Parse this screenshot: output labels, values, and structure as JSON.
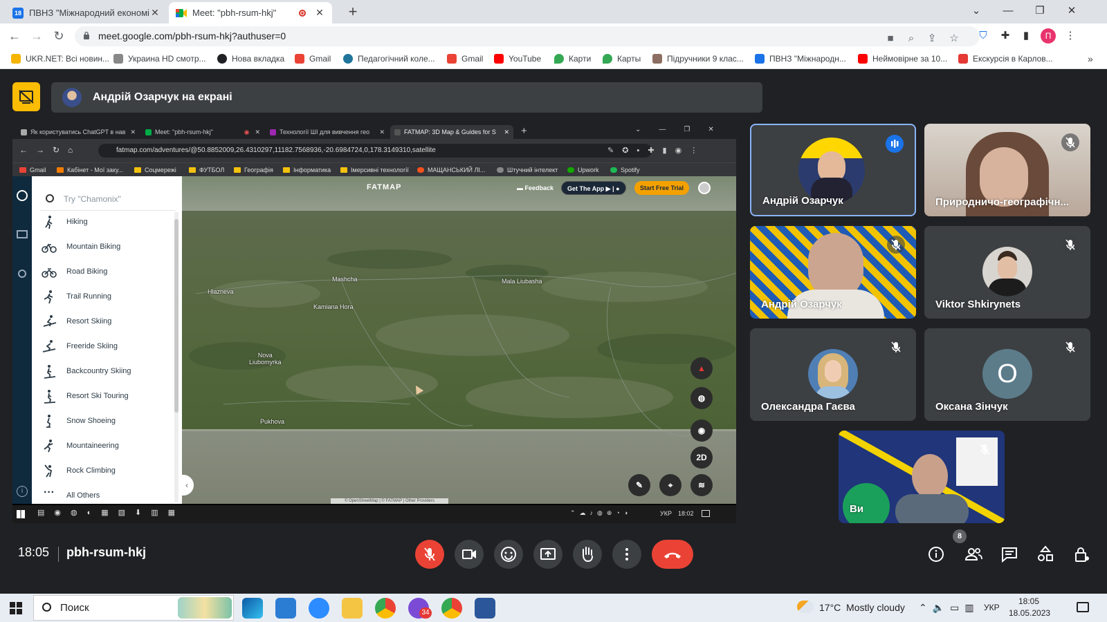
{
  "browser": {
    "tabs": [
      {
        "title": "ПВНЗ \"Міжнародний економіко",
        "favicon_color": "#1a73e8",
        "favicon_text": "18"
      },
      {
        "title": "Meet: \"pbh-rsum-hkj\"",
        "favicon_color": "#00ac47",
        "active": true
      }
    ],
    "window_controls": {
      "list": "⌄",
      "minimize": "—",
      "maximize": "❐",
      "close": "✕"
    },
    "new_tab": "+",
    "url": "meet.google.com/pbh-rsum-hkj?authuser=0",
    "profile_initial": "П",
    "bookmarks": [
      {
        "label": "UKR.NET: Всі новин...",
        "color": "#f4b400"
      },
      {
        "label": "Украина HD смотр...",
        "color": "#888888"
      },
      {
        "label": "Нова вкладка",
        "color": "#202124"
      },
      {
        "label": "Gmail",
        "color": "#ea4335"
      },
      {
        "label": "Педагогічний коле...",
        "color": "#21759b"
      },
      {
        "label": "Gmail",
        "color": "#ea4335"
      },
      {
        "label": "YouTube",
        "color": "#ff0000"
      },
      {
        "label": "Карти",
        "color": "#34a853"
      },
      {
        "label": "Карты",
        "color": "#34a853"
      },
      {
        "label": "Підручники 9 клас...",
        "color": "#8d6e63"
      },
      {
        "label": "ПВНЗ \"Міжнародн...",
        "color": "#1a73e8"
      },
      {
        "label": "Неймовірне за 10...",
        "color": "#ff0000"
      },
      {
        "label": "Екскурсія в Карлов...",
        "color": "#e53935"
      }
    ],
    "bookmarks_more": "»"
  },
  "meet": {
    "presenter_banner": "Андрій Озарчук на екрані",
    "time": "18:05",
    "meeting_code": "pbh-rsum-hkj",
    "participant_count": "8",
    "tiles": [
      {
        "name": "Андрій Озарчук",
        "type": "avatar",
        "speaking": true
      },
      {
        "name": "Природничо-географічн...",
        "type": "video",
        "muted": true
      },
      {
        "name": "Андрій Озарчук",
        "type": "video",
        "muted": true
      },
      {
        "name": "Viktor Shkirynets",
        "type": "avatar",
        "muted": true
      },
      {
        "name": "Олександра Гаєва",
        "type": "avatar",
        "muted": true
      },
      {
        "name": "Оксана Зінчук",
        "type": "letter",
        "letter": "О",
        "muted": true,
        "color": "#5c7c8a"
      },
      {
        "name": "Ви",
        "type": "video",
        "muted": true
      }
    ],
    "accent_red": "#ea4335",
    "accent_blue": "#8ab4f8"
  },
  "shared_screen": {
    "tabs": [
      {
        "title": "Як користуватись ChatGPT в нав",
        "color": "#aaaaaa"
      },
      {
        "title": "Meet: \"pbh-rsum-hkj\"",
        "color": "#00ac47"
      },
      {
        "title": "Технології ШІ для вивчення гео",
        "color": "#9c27b0"
      },
      {
        "title": "FATMAP: 3D Map & Guides for S",
        "color": "#555555",
        "active": true
      }
    ],
    "new_tab": "+",
    "url": "fatmap.com/adventures/@50.8852009,26.4310297,11182.7568936,-20.6984724,0,178.3149310,satellite",
    "bookmarks": [
      "Gmail",
      "Кабінет - Мої заку...",
      "Соцмережі",
      "ФУТБОЛ",
      "Географія",
      "Інформатика",
      "Імерсивні технології",
      "МАЩАНСЬКИЙ ЛІ...",
      "Штучний інтелект",
      "Upwork",
      "Spotify"
    ],
    "search_placeholder": "Try \"Chamonix\"",
    "activities": [
      "Hiking",
      "Mountain Biking",
      "Road Biking",
      "Trail Running",
      "Resort Skiing",
      "Freeride Skiing",
      "Backcountry Skiing",
      "Resort Ski Touring",
      "Snow Shoeing",
      "Mountaineering",
      "Rock Climbing",
      "All Others"
    ],
    "brand": "FATMAP",
    "feedback": "Feedback",
    "get_app": "Get The App",
    "trial": "Start Free Trial",
    "map_labels": [
      {
        "text": "Mashcha"
      },
      {
        "text": "Mala Liubasha"
      },
      {
        "text": "Hlazneva"
      },
      {
        "text": "Kamiana Hora"
      },
      {
        "text": "Nova\nLiubomyrka"
      },
      {
        "text": "Pukhova"
      }
    ],
    "map_controls": {
      "two_d": "2D"
    },
    "attribution": "© OpenStreetMap | © FATMAP | Other Providers",
    "taskbar_lang": "УКР",
    "taskbar_time": "18:02"
  },
  "windows_taskbar": {
    "search": "Поиск",
    "weather": "17°C  Mostly cloudy",
    "lang": "УКР",
    "time": "18:05",
    "date": "18.05.2023",
    "badge": "34"
  }
}
